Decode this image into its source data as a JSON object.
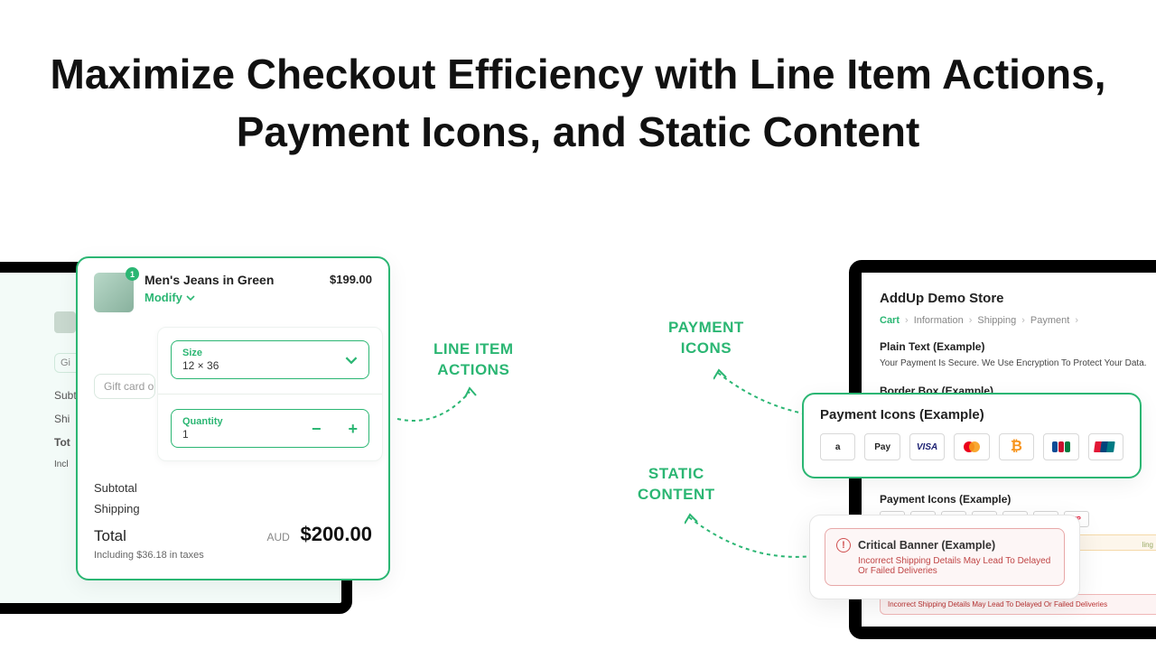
{
  "title": "Maximize Checkout Efficiency with Line Item Actions, Payment Icons, and Static Content",
  "annotations": {
    "line_item": "LINE ITEM\nACTIONS",
    "payment_icons": "PAYMENT\nICONS",
    "static_content": "STATIC\nCONTENT"
  },
  "cart": {
    "badge": "1",
    "product_name": "Men's Jeans in Green",
    "modify_label": "Modify",
    "price": "$199.00",
    "size_label": "Size",
    "size_value": "12 × 36",
    "quantity_label": "Quantity",
    "quantity_value": "1",
    "gift_placeholder": "Gift card or dis",
    "subtotal_label": "Subtotal",
    "shipping_label": "Shipping",
    "total_label": "Total",
    "currency": "AUD",
    "total_amount": "$200.00",
    "tax_note": "Including $36.18 in taxes"
  },
  "behind": {
    "thumb_img": "",
    "gift": "Gi",
    "sub": "Subt",
    "ship": "Shi",
    "tot": "Tot",
    "incl": "Incl"
  },
  "right": {
    "store": "AddUp Demo Store",
    "crumbs": [
      "Cart",
      "Information",
      "Shipping",
      "Payment"
    ],
    "plain_label": "Plain Text (Example)",
    "plain_text": "Your Payment Is Secure. We Use Encryption To Protect Your Data.",
    "border_label": "Border Box (Example)",
    "pay_label": "Payment Icons (Example)",
    "warn_mini": "Incorrect Shipping Details May Lead To Delayed Or Failed Deliveries",
    "orange_mini": "ling"
  },
  "pay_pop": {
    "header": "Payment Icons (Example)",
    "icons": [
      "a",
      "Pay",
      "VISA",
      "mc",
      "₿",
      "JCB",
      "UnionPay"
    ]
  },
  "crit_pop": {
    "title": "Critical Banner (Example)",
    "msg": "Incorrect Shipping Details May Lead To Delayed Or Failed Deliveries"
  }
}
